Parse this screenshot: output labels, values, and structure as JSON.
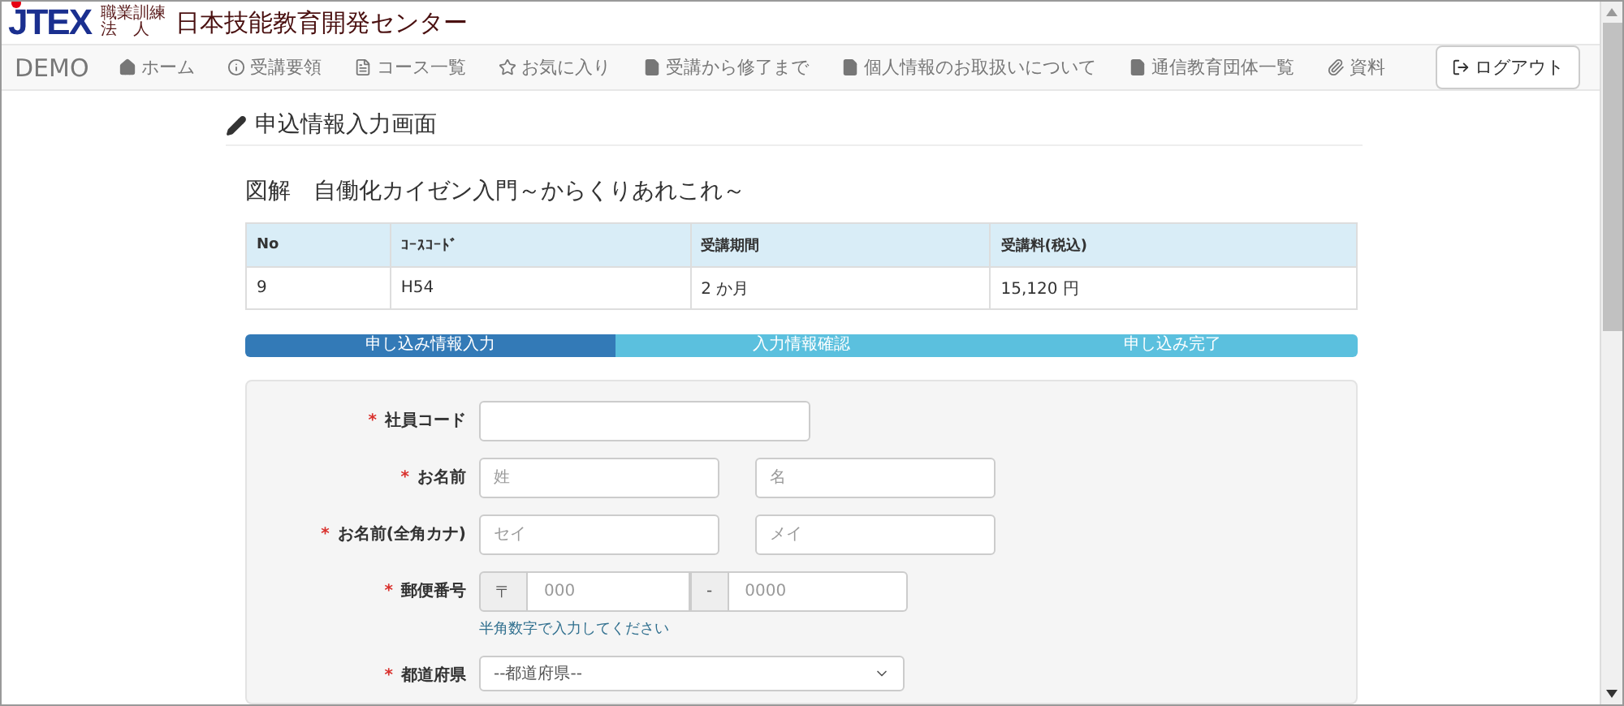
{
  "header": {
    "logo": "JTEX",
    "org_small": [
      "職業訓練",
      "法　人"
    ],
    "org_name": "日本技能教育開発センター"
  },
  "nav": {
    "brand": "DEMO",
    "items": [
      {
        "label": "ホーム"
      },
      {
        "label": "受講要領"
      },
      {
        "label": "コース一覧"
      },
      {
        "label": "お気に入り"
      },
      {
        "label": "受講から修了まで"
      },
      {
        "label": "個人情報のお取扱いについて"
      },
      {
        "label": "通信教育団体一覧"
      },
      {
        "label": "資料"
      }
    ],
    "logout": "ログアウト"
  },
  "page_title": "申込情報入力画面",
  "course_title": "図解　自働化カイゼン入門～からくりあれこれ～",
  "table": {
    "columns": [
      "No",
      "ｺｰｽｺｰﾄﾞ",
      "受講期間",
      "受講料(税込)"
    ],
    "rows": [
      [
        "9",
        "H54",
        "2 か月",
        "15,120 円"
      ]
    ]
  },
  "steps": [
    {
      "label": "申し込み情報入力",
      "selected": true
    },
    {
      "label": "入力情報確認",
      "selected": false
    },
    {
      "label": "申し込み完了",
      "selected": false
    }
  ],
  "form": [
    {
      "kind": "text",
      "label": "社員コード",
      "required_mark": "*"
    },
    {
      "kind": "pair",
      "label": "お名前",
      "required_mark": "*",
      "placeholders": [
        "姓",
        "名"
      ]
    },
    {
      "kind": "pair",
      "label": "お名前(全角カナ)",
      "required_mark": "*",
      "placeholders": [
        "セイ",
        "メイ"
      ]
    },
    {
      "kind": "postal",
      "label": "郵便番号",
      "required_mark": "*",
      "prefix": "〒",
      "separator": "-",
      "placeholders": [
        "000",
        "0000"
      ],
      "help": "半角数字で入力してください"
    },
    {
      "kind": "select",
      "label": "都道府県",
      "required_mark": "*",
      "value": "--都道府県--"
    }
  ]
}
